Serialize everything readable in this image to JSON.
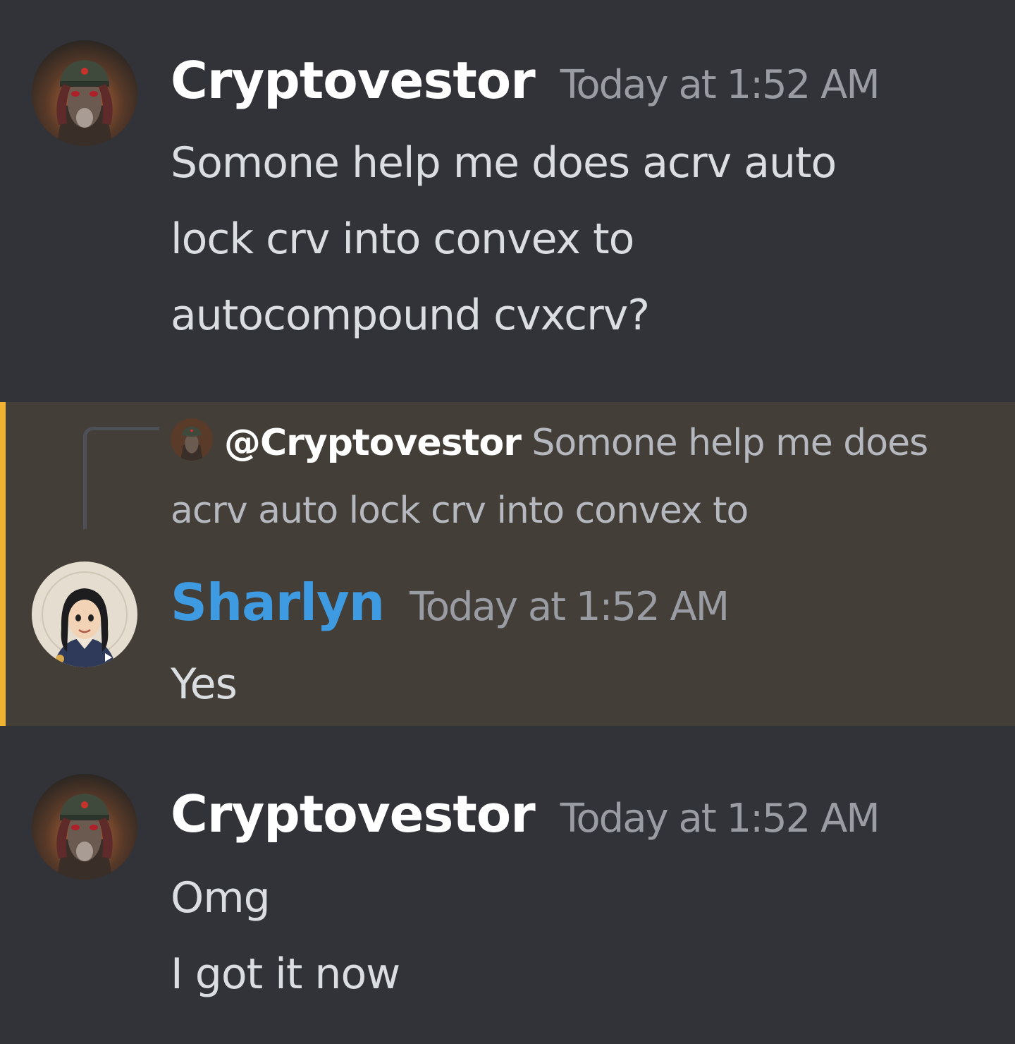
{
  "messages": [
    {
      "author": "Cryptovestor",
      "timestamp": "Today at 1:52 AM",
      "lines": [
        "Somone help me does acrv auto",
        "lock crv into convex to",
        "autocompound cvxcrv?"
      ]
    },
    {
      "reply": {
        "mention": "@Cryptovestor",
        "text": "Somone help me does acrv auto lock crv into convex to"
      },
      "author": "Sharlyn",
      "timestamp": "Today at 1:52 AM",
      "lines": [
        "Yes"
      ]
    },
    {
      "author": "Cryptovestor",
      "timestamp": "Today at 1:52 AM",
      "lines": [
        "Omg",
        "I got it now"
      ]
    }
  ],
  "colors": {
    "background": "#313338",
    "highlight_background": "#433e38",
    "highlight_bar": "#f0b232",
    "author_sharlyn": "#3e9be2",
    "timestamp": "#9a9ca3"
  },
  "icons": {
    "avatar_cryptovestor": "llama-in-soldier-hat-avatar",
    "avatar_sharlyn": "cartoon-woman-avatar"
  }
}
